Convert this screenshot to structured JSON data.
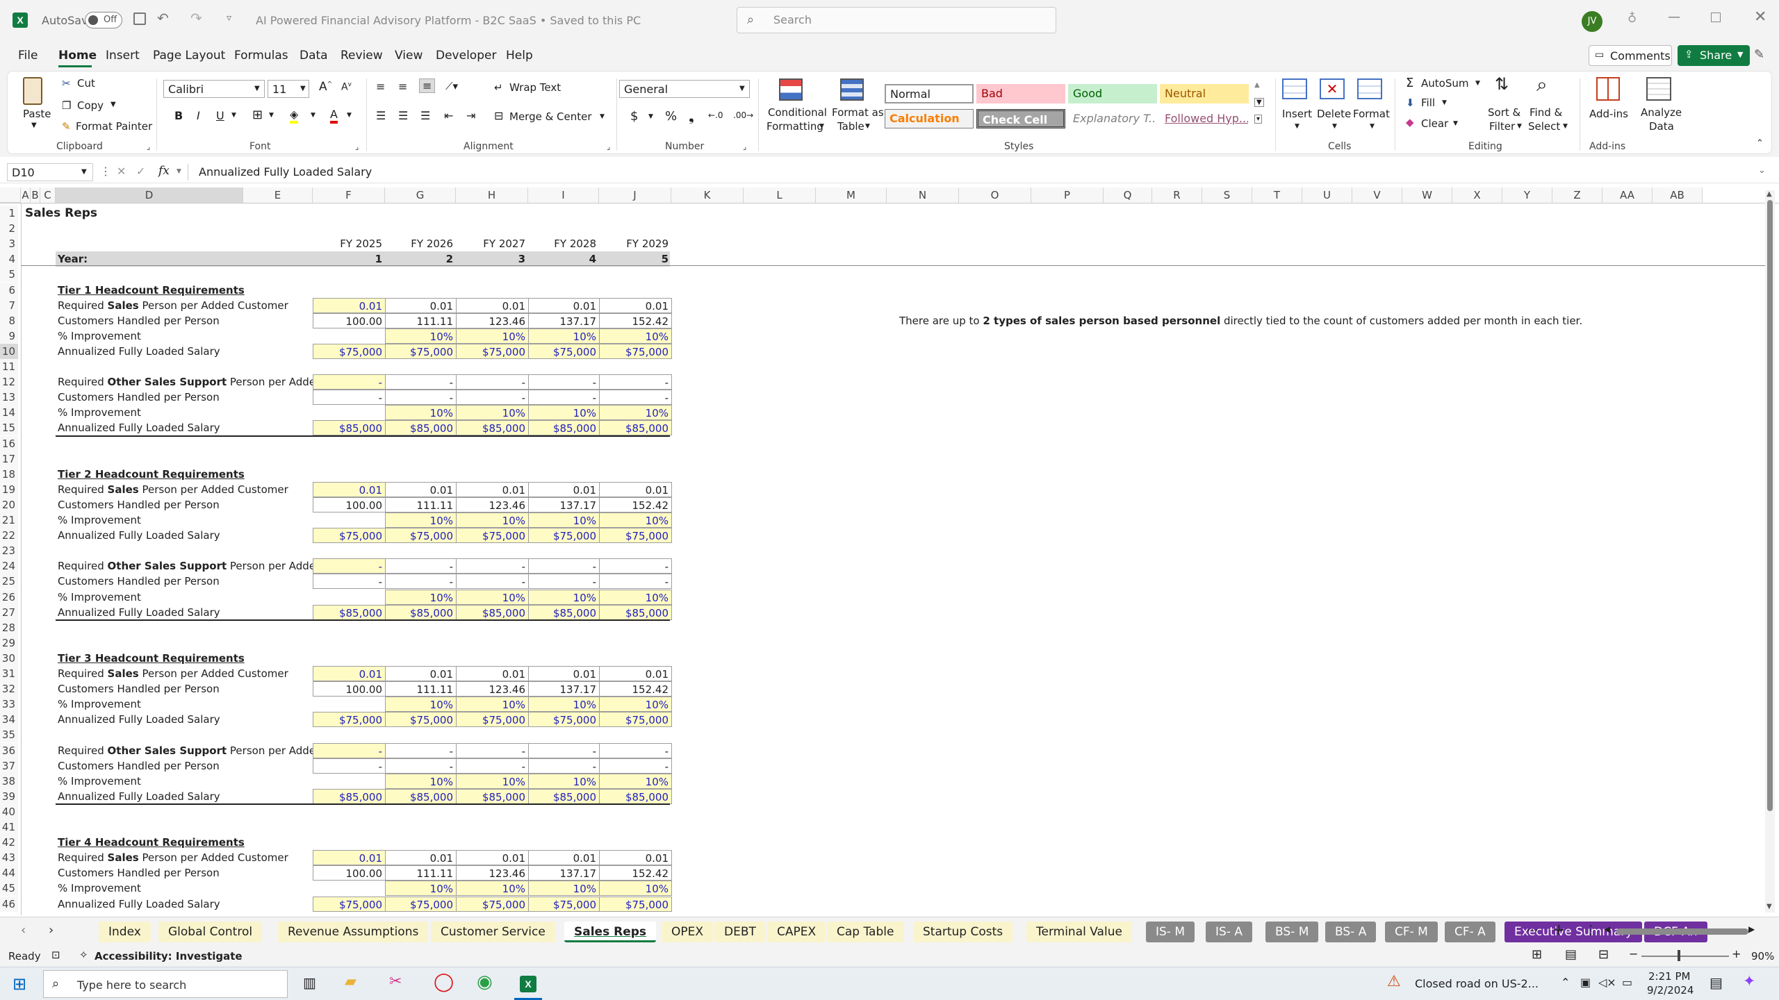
{
  "titlebar": {
    "autosave": "AutoSave",
    "autosave_state": "Off",
    "doc_title": "AI Powered Financial Advisory Platform - B2C SaaS • Saved to this PC",
    "search_placeholder": "Search",
    "avatar": "JV"
  },
  "menu": [
    "File",
    "Home",
    "Insert",
    "Page Layout",
    "Formulas",
    "Data",
    "Review",
    "View",
    "Developer",
    "Help"
  ],
  "menu_active": "Home",
  "actions": {
    "comments": "Comments",
    "share": "Share"
  },
  "ribbon": {
    "clipboard": {
      "paste": "Paste",
      "cut": "Cut",
      "copy": "Copy",
      "format_painter": "Format Painter",
      "label": "Clipboard"
    },
    "font": {
      "name": "Calibri",
      "size": "11",
      "label": "Font"
    },
    "alignment": {
      "wrap": "Wrap Text",
      "merge": "Merge & Center",
      "label": "Alignment"
    },
    "number": {
      "format": "General",
      "label": "Number"
    },
    "styles": {
      "cond": [
        "Conditional",
        "Formatting"
      ],
      "table": [
        "Format as",
        "Table"
      ],
      "normal": "Normal",
      "bad": "Bad",
      "good": "Good",
      "neutral": "Neutral",
      "calculation": "Calculation",
      "check": "Check Cell",
      "explanatory": "Explanatory T...",
      "followed": "Followed Hyp...",
      "label": "Styles"
    },
    "cells": {
      "insert": "Insert",
      "delete": "Delete",
      "format": "Format",
      "label": "Cells"
    },
    "editing": {
      "autosum": "AutoSum",
      "fill": "Fill",
      "clear": "Clear",
      "sort": [
        "Sort &",
        "Filter"
      ],
      "find": [
        "Find &",
        "Select"
      ],
      "label": "Editing"
    },
    "addins": {
      "addins": "Add-ins",
      "analyze": [
        "Analyze",
        "Data"
      ],
      "label": "Add-ins"
    }
  },
  "formula_bar": {
    "name_box": "D10",
    "fx": "fx",
    "formula": "Annualized Fully Loaded Salary"
  },
  "columns": [
    "A",
    "B",
    "C",
    "D",
    "E",
    "F",
    "G",
    "H",
    "I",
    "J",
    "K",
    "L",
    "M",
    "N",
    "O",
    "P",
    "Q",
    "R",
    "S",
    "T",
    "U",
    "V",
    "W",
    "X",
    "Y",
    "Z",
    "AA",
    "AB"
  ],
  "sheet": {
    "title": "Sales Reps",
    "fy_labels": [
      "FY 2025",
      "FY 2026",
      "FY 2027",
      "FY 2028",
      "FY 2029"
    ],
    "year_label": "Year:",
    "year_nums": [
      "1",
      "2",
      "3",
      "4",
      "5"
    ],
    "note": {
      "a": "There are up to ",
      "b": "2 types of sales person based personnel",
      "c": " directly tied to the count of customers added per month in each tier."
    },
    "row_numbers": [
      "1",
      "2",
      "3",
      "4",
      "5",
      "6",
      "7",
      "8",
      "9",
      "10",
      "11",
      "12",
      "13",
      "14",
      "15",
      "16",
      "17",
      "18",
      "19",
      "20",
      "21",
      "22",
      "23",
      "24",
      "25",
      "26",
      "27",
      "28",
      "29",
      "30",
      "31",
      "32",
      "33",
      "34",
      "35",
      "36",
      "37",
      "38",
      "39",
      "40",
      "41",
      "42",
      "43",
      "44",
      "45",
      "46"
    ],
    "labels": {
      "req_pre": "Required ",
      "sales": "Sales",
      "req_post": " Person per Added Customer",
      "other": "Other Sales Support",
      "handled": "Customers Handled per Person",
      "improvement": "% Improvement",
      "salary": "Annualized Fully Loaded Salary"
    },
    "tiers": [
      {
        "title": "Tier 1 Headcount Requirements",
        "sales_req": [
          "0.01",
          "0.01",
          "0.01",
          "0.01",
          "0.01"
        ],
        "sales_handled": [
          "100.00",
          "111.11",
          "123.46",
          "137.17",
          "152.42"
        ],
        "sales_impr": [
          "",
          "10%",
          "10%",
          "10%",
          "10%"
        ],
        "sales_salary": [
          "$75,000",
          "$75,000",
          "$75,000",
          "$75,000",
          "$75,000"
        ],
        "other_req": [
          "-",
          "-",
          "-",
          "-",
          "-"
        ],
        "other_handled": [
          "-",
          "-",
          "-",
          "-",
          "-"
        ],
        "other_impr": [
          "",
          "10%",
          "10%",
          "10%",
          "10%"
        ],
        "other_salary": [
          "$85,000",
          "$85,000",
          "$85,000",
          "$85,000",
          "$85,000"
        ]
      },
      {
        "title": "Tier 2 Headcount Requirements",
        "sales_req": [
          "0.01",
          "0.01",
          "0.01",
          "0.01",
          "0.01"
        ],
        "sales_handled": [
          "100.00",
          "111.11",
          "123.46",
          "137.17",
          "152.42"
        ],
        "sales_impr": [
          "",
          "10%",
          "10%",
          "10%",
          "10%"
        ],
        "sales_salary": [
          "$75,000",
          "$75,000",
          "$75,000",
          "$75,000",
          "$75,000"
        ],
        "other_req": [
          "-",
          "-",
          "-",
          "-",
          "-"
        ],
        "other_handled": [
          "-",
          "-",
          "-",
          "-",
          "-"
        ],
        "other_impr": [
          "",
          "10%",
          "10%",
          "10%",
          "10%"
        ],
        "other_salary": [
          "$85,000",
          "$85,000",
          "$85,000",
          "$85,000",
          "$85,000"
        ]
      },
      {
        "title": "Tier 3 Headcount Requirements",
        "sales_req": [
          "0.01",
          "0.01",
          "0.01",
          "0.01",
          "0.01"
        ],
        "sales_handled": [
          "100.00",
          "111.11",
          "123.46",
          "137.17",
          "152.42"
        ],
        "sales_impr": [
          "",
          "10%",
          "10%",
          "10%",
          "10%"
        ],
        "sales_salary": [
          "$75,000",
          "$75,000",
          "$75,000",
          "$75,000",
          "$75,000"
        ],
        "other_req": [
          "-",
          "-",
          "-",
          "-",
          "-"
        ],
        "other_handled": [
          "-",
          "-",
          "-",
          "-",
          "-"
        ],
        "other_impr": [
          "",
          "10%",
          "10%",
          "10%",
          "10%"
        ],
        "other_salary": [
          "$85,000",
          "$85,000",
          "$85,000",
          "$85,000",
          "$85,000"
        ]
      },
      {
        "title": "Tier 4 Headcount Requirements",
        "sales_req": [
          "0.01",
          "0.01",
          "0.01",
          "0.01",
          "0.01"
        ],
        "sales_handled": [
          "100.00",
          "111.11",
          "123.46",
          "137.17",
          "152.42"
        ],
        "sales_impr": [
          "",
          "10%",
          "10%",
          "10%",
          "10%"
        ],
        "sales_salary": [
          "$75,000",
          "$75,000",
          "$75,000",
          "$75,000",
          "$75,000"
        ]
      }
    ]
  },
  "tabs": [
    {
      "label": "Index",
      "color": "#f9f4cc",
      "fg": "#222"
    },
    {
      "label": "Global Control",
      "color": "#f9f4cc",
      "fg": "#222"
    },
    {
      "label": "Revenue Assumptions",
      "color": "#f9f4cc",
      "fg": "#222"
    },
    {
      "label": "Customer Service",
      "color": "#f9f4cc",
      "fg": "#222"
    },
    {
      "label": "Sales Reps",
      "color": "#ffffff",
      "fg": "#222",
      "active": true
    },
    {
      "label": "OPEX",
      "color": "#f9f4cc",
      "fg": "#222"
    },
    {
      "label": "DEBT",
      "color": "#f9f4cc",
      "fg": "#222"
    },
    {
      "label": "CAPEX",
      "color": "#f9f4cc",
      "fg": "#222"
    },
    {
      "label": "Cap Table",
      "color": "#f9f4cc",
      "fg": "#222"
    },
    {
      "label": "Startup Costs",
      "color": "#f9f4cc",
      "fg": "#222"
    },
    {
      "label": "Terminal Value",
      "color": "#f9f4cc",
      "fg": "#222"
    },
    {
      "label": "IS- M",
      "color": "#8a8a8a",
      "fg": "#fff"
    },
    {
      "label": "IS- A",
      "color": "#8a8a8a",
      "fg": "#fff"
    },
    {
      "label": "BS- M",
      "color": "#8a8a8a",
      "fg": "#fff"
    },
    {
      "label": "BS- A",
      "color": "#8a8a8a",
      "fg": "#fff"
    },
    {
      "label": "CF- M",
      "color": "#8a8a8a",
      "fg": "#fff"
    },
    {
      "label": "CF- A",
      "color": "#8a8a8a",
      "fg": "#fff"
    },
    {
      "label": "Executive Summary",
      "color": "#7030a0",
      "fg": "#fff"
    },
    {
      "label": "DCF An",
      "color": "#7030a0",
      "fg": "#fff"
    }
  ],
  "status": {
    "ready": "Ready",
    "accessibility": "Accessibility: Investigate",
    "zoom": "90%"
  },
  "taskbar": {
    "search": "Type here to search",
    "news": "Closed road on US-2...",
    "time": "2:21 PM",
    "date": "9/2/2024"
  },
  "colors": {
    "excel_green": "#107c41",
    "input_blue": "#1f1fbf",
    "input_yellow": "#fffbc4",
    "purple_tab": "#7030a0"
  }
}
